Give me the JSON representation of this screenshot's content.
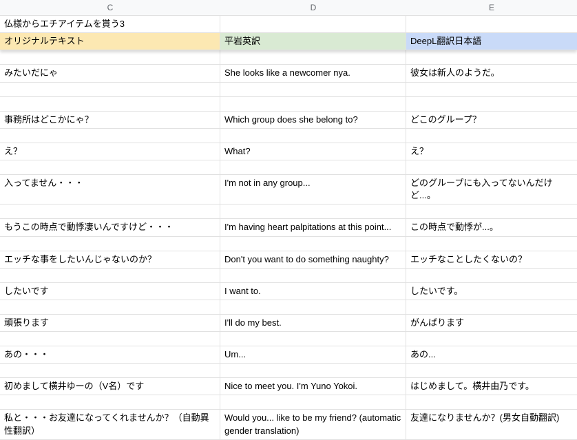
{
  "columns": {
    "C": "C",
    "D": "D",
    "E": "E"
  },
  "title": "仏様からエチアイテムを貰う3",
  "headers": {
    "C": "オリジナルテキスト",
    "D": "平岩英訳",
    "E": "DeepL翻訳日本語"
  },
  "rows": [
    {
      "C": "",
      "D": "",
      "E": ""
    },
    {
      "C": "みたいだにゃ",
      "D": "She looks like a newcomer nya.",
      "E": "彼女は新人のようだ。"
    },
    {
      "C": "",
      "D": "",
      "E": ""
    },
    {
      "C": "",
      "D": "",
      "E": ""
    },
    {
      "C": "事務所はどこかにゃ？",
      "D": "Which group does she belong to?",
      "E": "どこのグループ？"
    },
    {
      "C": "",
      "D": "",
      "E": ""
    },
    {
      "C": "え？",
      "D": "What?",
      "E": "え？"
    },
    {
      "C": "",
      "D": "",
      "E": ""
    },
    {
      "C": "入ってません・・・",
      "D": "I'm not in any group...",
      "E": "どのグループにも入ってないんだけど...。",
      "wrapE": true
    },
    {
      "C": "",
      "D": "",
      "E": ""
    },
    {
      "C": "もうこの時点で動悸凄いんですけど・・・",
      "D": "I'm having heart palpitations at this point...",
      "E": "この時点で動悸が...。"
    },
    {
      "C": "",
      "D": "",
      "E": ""
    },
    {
      "C": "エッチな事をしたいんじゃないのか？",
      "D": "Don't you want to do something naughty?",
      "E": "エッチなことしたくないの？"
    },
    {
      "C": "",
      "D": "",
      "E": ""
    },
    {
      "C": "したいです",
      "D": "I want to.",
      "E": "したいです。"
    },
    {
      "C": "",
      "D": "",
      "E": ""
    },
    {
      "C": "頑張ります",
      "D": "I'll do my best.",
      "E": "がんばります"
    },
    {
      "C": "",
      "D": "",
      "E": ""
    },
    {
      "C": "あの・・・",
      "D": "Um...",
      "E": "あの..."
    },
    {
      "C": "",
      "D": "",
      "E": ""
    },
    {
      "C": "初めまして横井ゆーの（V名）です",
      "D": "Nice to meet you. I'm Yuno Yokoi.",
      "E": "はじめまして。横井由乃です。"
    },
    {
      "C": "",
      "D": "",
      "E": ""
    },
    {
      "C": "私と・・・お友達になってくれませんか？（自動異性翻訳）",
      "D": "Would you... like to be my friend? (automatic gender translation)",
      "E": "友達になりませんか？(男女自動翻訳)",
      "wrapC": true,
      "wrapD": true
    }
  ]
}
